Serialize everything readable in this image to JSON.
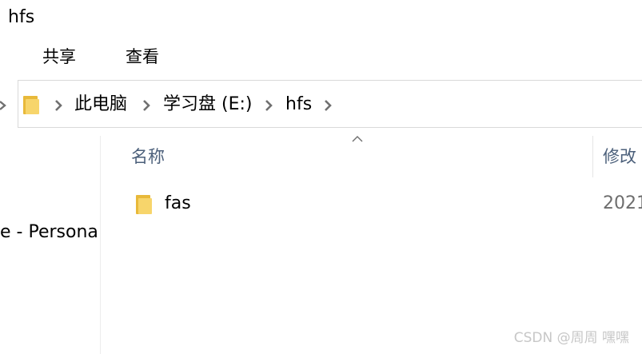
{
  "window": {
    "title": "hfs"
  },
  "ribbon": {
    "tabs": [
      {
        "label": "共享"
      },
      {
        "label": "查看"
      }
    ]
  },
  "address_bar": {
    "breadcrumbs": [
      {
        "label": "此电脑"
      },
      {
        "label": "学习盘 (E:)"
      },
      {
        "label": "hfs"
      }
    ]
  },
  "nav_pane": {
    "visible_item": "e - Persona"
  },
  "file_list": {
    "columns": [
      {
        "label": "名称",
        "sorted": "ascending"
      },
      {
        "label": "修改"
      }
    ],
    "rows": [
      {
        "name": "fas",
        "modified": "2021",
        "type_icon": "folder-icon"
      }
    ]
  },
  "watermark": {
    "text": "CSDN @周周  嘿嘿"
  },
  "colors": {
    "folder": "#f2c94c",
    "header_text": "#4b5f7a",
    "chevron": "#707070"
  }
}
